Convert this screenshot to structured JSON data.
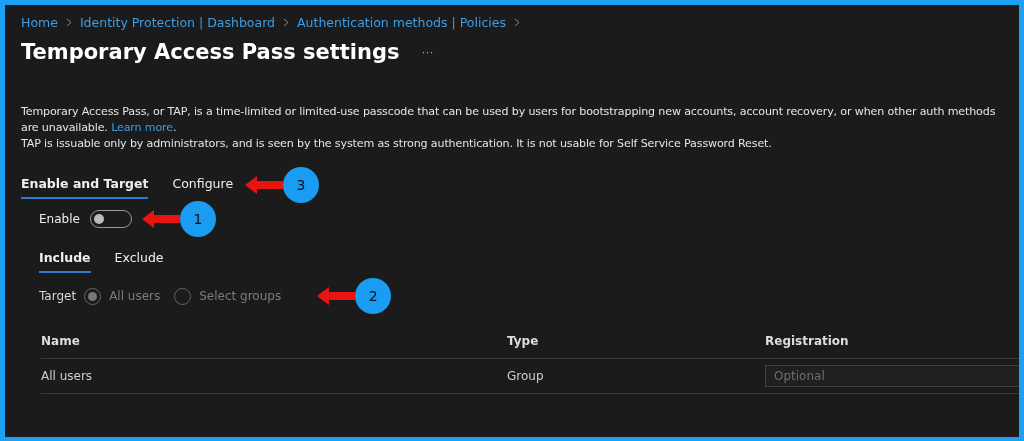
{
  "breadcrumb": [
    {
      "label": "Home"
    },
    {
      "label": "Identity Protection | Dashboard"
    },
    {
      "label": "Authentication methods | Policies"
    }
  ],
  "title": "Temporary Access Pass settings",
  "more_button": "···",
  "description": {
    "line_1": "Temporary Access Pass, or TAP, is a time-limited or limited-use passcode that can be used by users for bootstrapping new accounts, account recovery, or when other auth methods are unavailable.",
    "link": "Learn more",
    "line_1_end": ".",
    "line_2": "TAP is issuable only by administrators, and is seen by the system as strong authentication. It is not usable for Self Service Password Reset."
  },
  "tabs": [
    {
      "label": "Enable and Target",
      "selected": true
    },
    {
      "label": "Configure",
      "selected": false,
      "callout": "3"
    }
  ],
  "enable": {
    "label": "Enable",
    "on": false,
    "callout": "1"
  },
  "sub_tabs": [
    {
      "label": "Include",
      "selected": true
    },
    {
      "label": "Exclude",
      "selected": false
    }
  ],
  "target": {
    "label": "Target",
    "disabled": true,
    "callout": "2",
    "options": [
      {
        "label": "All users",
        "selected": true
      },
      {
        "label": "Select groups",
        "selected": false
      }
    ]
  },
  "table": {
    "columns": [
      "Name",
      "Type",
      "Registration"
    ],
    "rows": [
      {
        "name": "All users",
        "type": "Group",
        "registration": {
          "placeholder": "Optional",
          "disabled": true
        }
      }
    ]
  }
}
